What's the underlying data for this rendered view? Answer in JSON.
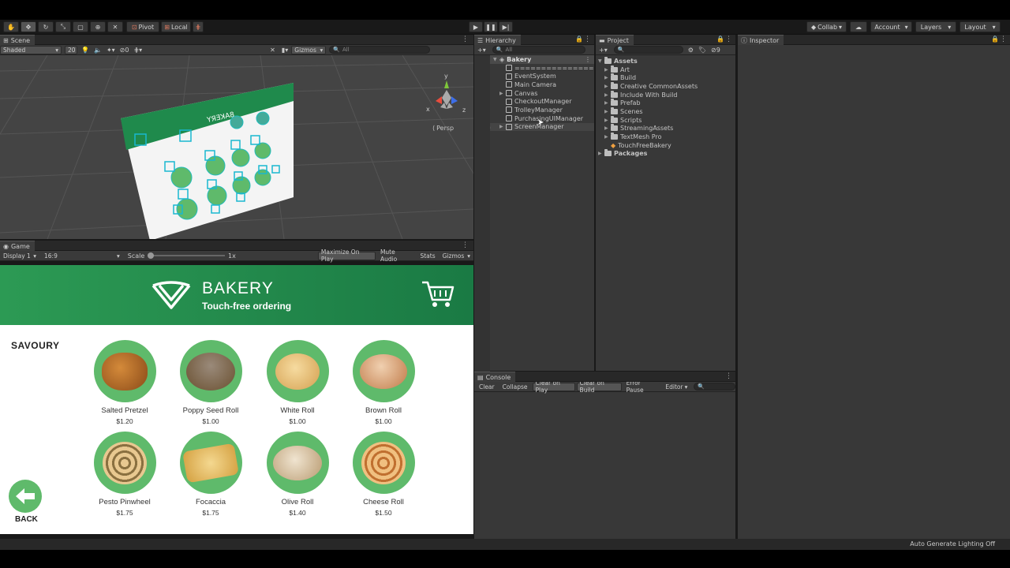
{
  "toolbar": {
    "pivot": "Pivot",
    "local": "Local",
    "collab": "Collab",
    "account": "Account",
    "layers": "Layers",
    "layout": "Layout"
  },
  "scene": {
    "tab": "Scene",
    "shading": "Shaded",
    "mode_2d": "20",
    "hidden_count": "0",
    "gizmos": "Gizmos",
    "search_placeholder": "All",
    "persp": "Persp",
    "axis_y": "y",
    "axis_x": "x",
    "axis_z": "z"
  },
  "game": {
    "tab": "Game",
    "display": "Display 1",
    "aspect": "16:9",
    "scale_label": "Scale",
    "scale_value": "1x",
    "maximize": "Maximize On Play",
    "mute": "Mute Audio",
    "stats": "Stats",
    "gizmos": "Gizmos"
  },
  "bakery": {
    "title": "BAKERY",
    "subtitle": "Touch-free ordering",
    "category": "SAVOURY",
    "back": "BACK",
    "products": [
      {
        "name": "Salted Pretzel",
        "price": "$1.20"
      },
      {
        "name": "Poppy Seed Roll",
        "price": "$1.00"
      },
      {
        "name": "White Roll",
        "price": "$1.00"
      },
      {
        "name": "Brown Roll",
        "price": "$1.00"
      },
      {
        "name": "Pesto Pinwheel",
        "price": "$1.75"
      },
      {
        "name": "Focaccia",
        "price": "$1.75"
      },
      {
        "name": "Olive Roll",
        "price": "$1.40"
      },
      {
        "name": "Cheese Roll",
        "price": "$1.50"
      }
    ],
    "colors": {
      "brand_green": "#1f8a4c",
      "circle_green": "#5fba6b"
    }
  },
  "hierarchy": {
    "tab": "Hierarchy",
    "search_placeholder": "All",
    "scene_name": "Bakery",
    "items": [
      "===============",
      "EventSystem",
      "Main Camera",
      "Canvas",
      "CheckoutManager",
      "TrolleyManager",
      "PurchasingUIManager",
      "ScreenManager"
    ]
  },
  "project": {
    "tab": "Project",
    "hidden_count": "9",
    "root": "Assets",
    "folders": [
      "Art",
      "Build",
      "Creative CommonAssets",
      "Include With Build",
      "Prefab",
      "Scenes",
      "Scripts",
      "StreamingAssets",
      "TextMesh Pro"
    ],
    "scene_file": "TouchFreeBakery",
    "packages": "Packages"
  },
  "inspector": {
    "tab": "Inspector"
  },
  "console": {
    "tab": "Console",
    "clear": "Clear",
    "collapse": "Collapse",
    "clear_on_play": "Clear on Play",
    "clear_on_build": "Clear on Build",
    "error_pause": "Error Pause",
    "editor": "Editor"
  },
  "status": {
    "lighting": "Auto Generate Lighting Off"
  }
}
